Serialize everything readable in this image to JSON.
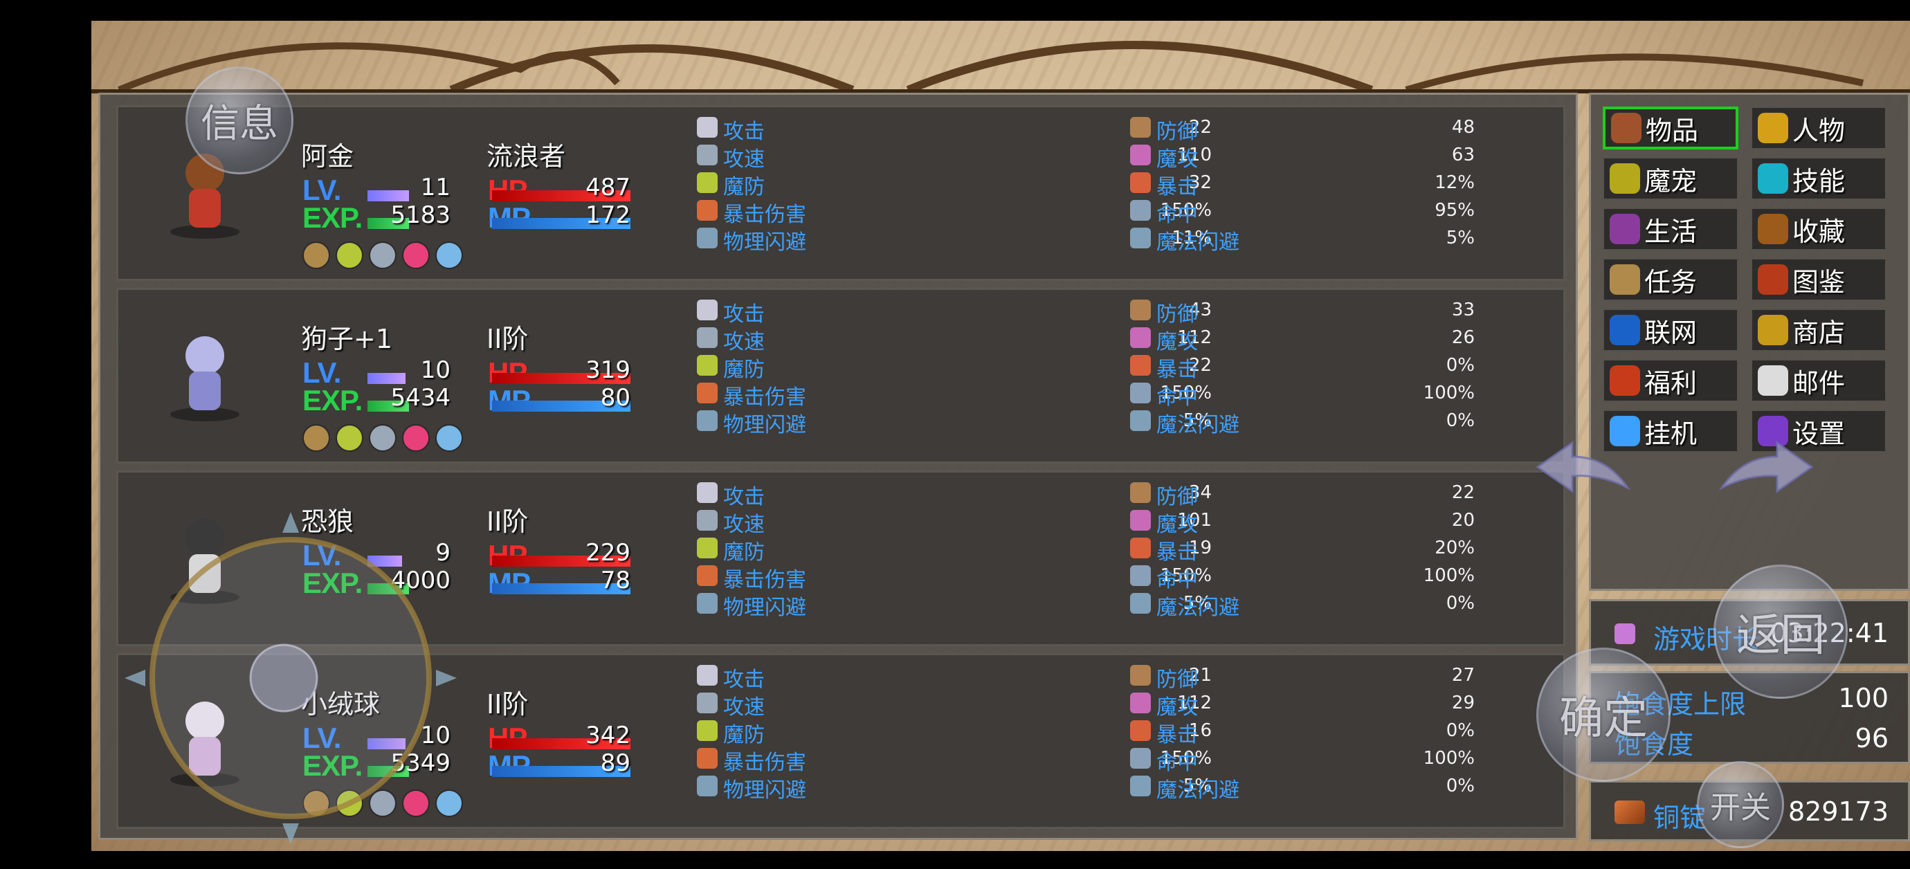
{
  "characters": [
    {
      "name": "阿金",
      "class": "流浪者",
      "lv_label": "LV.",
      "lv": "11",
      "exp_label": "EXP.",
      "exp": "5183",
      "hp_label": "HP",
      "hp": "487",
      "mp_label": "MP",
      "mp": "172",
      "stats_left": [
        {
          "name": "攻击",
          "value": "22"
        },
        {
          "name": "攻速",
          "value": "110"
        },
        {
          "name": "魔防",
          "value": "32"
        },
        {
          "name": "暴击伤害",
          "value": "150%"
        },
        {
          "name": "物理闪避",
          "value": "11%"
        }
      ],
      "stats_right": [
        {
          "name": "防御",
          "value": "48"
        },
        {
          "name": "魔攻",
          "value": "63"
        },
        {
          "name": "暴击",
          "value": "12%"
        },
        {
          "name": "命中",
          "value": "95%"
        },
        {
          "name": "魔法闪避",
          "value": "5%"
        }
      ]
    },
    {
      "name": "狗子+1",
      "class": "II阶",
      "lv_label": "LV.",
      "lv": "10",
      "exp_label": "EXP.",
      "exp": "5434",
      "hp_label": "HP",
      "hp": "319",
      "mp_label": "MP",
      "mp": "80",
      "stats_left": [
        {
          "name": "攻击",
          "value": "43"
        },
        {
          "name": "攻速",
          "value": "112"
        },
        {
          "name": "魔防",
          "value": "22"
        },
        {
          "name": "暴击伤害",
          "value": "150%"
        },
        {
          "name": "物理闪避",
          "value": "5%"
        }
      ],
      "stats_right": [
        {
          "name": "防御",
          "value": "33"
        },
        {
          "name": "魔攻",
          "value": "26"
        },
        {
          "name": "暴击",
          "value": "0%"
        },
        {
          "name": "命中",
          "value": "100%"
        },
        {
          "name": "魔法闪避",
          "value": "0%"
        }
      ]
    },
    {
      "name": "恐狼",
      "class": "II阶",
      "lv_label": "LV.",
      "lv": "9",
      "exp_label": "EXP.",
      "exp": "4000",
      "hp_label": "HP",
      "hp": "229",
      "mp_label": "MP",
      "mp": "78",
      "stats_left": [
        {
          "name": "攻击",
          "value": "34"
        },
        {
          "name": "攻速",
          "value": "101"
        },
        {
          "name": "魔防",
          "value": "19"
        },
        {
          "name": "暴击伤害",
          "value": "150%"
        },
        {
          "name": "物理闪避",
          "value": "5%"
        }
      ],
      "stats_right": [
        {
          "name": "防御",
          "value": "22"
        },
        {
          "name": "魔攻",
          "value": "20"
        },
        {
          "name": "暴击",
          "value": "20%"
        },
        {
          "name": "命中",
          "value": "100%"
        },
        {
          "name": "魔法闪避",
          "value": "0%"
        }
      ]
    },
    {
      "name": "小绒球",
      "class": "II阶",
      "lv_label": "LV.",
      "lv": "10",
      "exp_label": "EXP.",
      "exp": "5349",
      "hp_label": "HP",
      "hp": "342",
      "mp_label": "MP",
      "mp": "89",
      "stats_left": [
        {
          "name": "攻击",
          "value": "21"
        },
        {
          "name": "攻速",
          "value": "112"
        },
        {
          "name": "魔防",
          "value": "16"
        },
        {
          "name": "暴击伤害",
          "value": "150%"
        },
        {
          "name": "物理闪避",
          "value": "5%"
        }
      ],
      "stats_right": [
        {
          "name": "防御",
          "value": "27"
        },
        {
          "name": "魔攻",
          "value": "29"
        },
        {
          "name": "暴击",
          "value": "0%"
        },
        {
          "name": "命中",
          "value": "100%"
        },
        {
          "name": "魔法闪避",
          "value": "0%"
        }
      ]
    }
  ],
  "menu": [
    {
      "label": "物品",
      "icon": "bag-icon",
      "color": "#a0522d",
      "selected": true
    },
    {
      "label": "人物",
      "icon": "helmet-icon",
      "color": "#d4a017"
    },
    {
      "label": "魔宠",
      "icon": "egg-icon",
      "color": "#b5a81a"
    },
    {
      "label": "技能",
      "icon": "skill-icon",
      "color": "#1ab0c8"
    },
    {
      "label": "生活",
      "icon": "book-icon",
      "color": "#8a3b9c"
    },
    {
      "label": "收藏",
      "icon": "collection-icon",
      "color": "#9c5b1a"
    },
    {
      "label": "任务",
      "icon": "scroll-icon",
      "color": "#b08a4a"
    },
    {
      "label": "图鉴",
      "icon": "codex-icon",
      "color": "#b73b1a"
    },
    {
      "label": "联网",
      "icon": "computer-icon",
      "color": "#1a62c8"
    },
    {
      "label": "商店",
      "icon": "shop-icon",
      "color": "#c89a1a"
    },
    {
      "label": "福利",
      "icon": "chest-icon",
      "color": "#c83b1a"
    },
    {
      "label": "邮件",
      "icon": "mail-icon",
      "color": "#dcdcdc"
    },
    {
      "label": "挂机",
      "icon": "sleep-icon",
      "color": "#3ba0ff"
    },
    {
      "label": "设置",
      "icon": "gear-icon",
      "color": "#7a3bc8"
    }
  ],
  "status": {
    "play_time_label": "游戏时长",
    "play_time": "03:22:41",
    "satiety_max_label": "饱食度上限",
    "satiety_max": "100",
    "satiety_label": "饱食度",
    "satiety": "96",
    "copper_label": "铜锭",
    "copper": "829173"
  },
  "overlay": {
    "info_button": "信息",
    "back_button": "返回",
    "confirm_button": "确定",
    "toggle_button": "开关"
  },
  "colors": {
    "stat_label": "#3da0ff",
    "selected_border": "#19d11e"
  }
}
